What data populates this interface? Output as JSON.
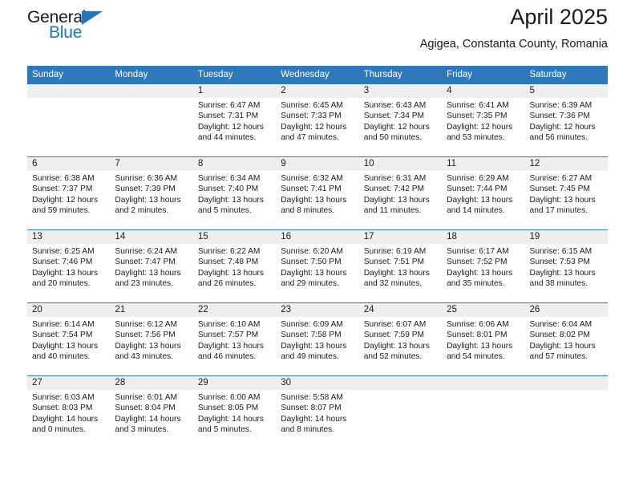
{
  "brand": {
    "name_top": "General",
    "name_bottom": "Blue",
    "triangle_color": "#1f77bd"
  },
  "header": {
    "title": "April 2025",
    "subtitle": "Agigea, Constanta County, Romania",
    "accent_color": "#2e79bb"
  },
  "calendar": {
    "weekday_headers": [
      "Sunday",
      "Monday",
      "Tuesday",
      "Wednesday",
      "Thursday",
      "Friday",
      "Saturday"
    ],
    "band_color": "#efefef",
    "weeks": [
      [
        {
          "day": "",
          "lines": []
        },
        {
          "day": "",
          "lines": []
        },
        {
          "day": "1",
          "lines": [
            "Sunrise: 6:47 AM",
            "Sunset: 7:31 PM",
            "Daylight: 12 hours",
            "and 44 minutes."
          ]
        },
        {
          "day": "2",
          "lines": [
            "Sunrise: 6:45 AM",
            "Sunset: 7:33 PM",
            "Daylight: 12 hours",
            "and 47 minutes."
          ]
        },
        {
          "day": "3",
          "lines": [
            "Sunrise: 6:43 AM",
            "Sunset: 7:34 PM",
            "Daylight: 12 hours",
            "and 50 minutes."
          ]
        },
        {
          "day": "4",
          "lines": [
            "Sunrise: 6:41 AM",
            "Sunset: 7:35 PM",
            "Daylight: 12 hours",
            "and 53 minutes."
          ]
        },
        {
          "day": "5",
          "lines": [
            "Sunrise: 6:39 AM",
            "Sunset: 7:36 PM",
            "Daylight: 12 hours",
            "and 56 minutes."
          ]
        }
      ],
      [
        {
          "day": "6",
          "lines": [
            "Sunrise: 6:38 AM",
            "Sunset: 7:37 PM",
            "Daylight: 12 hours",
            "and 59 minutes."
          ]
        },
        {
          "day": "7",
          "lines": [
            "Sunrise: 6:36 AM",
            "Sunset: 7:39 PM",
            "Daylight: 13 hours",
            "and 2 minutes."
          ]
        },
        {
          "day": "8",
          "lines": [
            "Sunrise: 6:34 AM",
            "Sunset: 7:40 PM",
            "Daylight: 13 hours",
            "and 5 minutes."
          ]
        },
        {
          "day": "9",
          "lines": [
            "Sunrise: 6:32 AM",
            "Sunset: 7:41 PM",
            "Daylight: 13 hours",
            "and 8 minutes."
          ]
        },
        {
          "day": "10",
          "lines": [
            "Sunrise: 6:31 AM",
            "Sunset: 7:42 PM",
            "Daylight: 13 hours",
            "and 11 minutes."
          ]
        },
        {
          "day": "11",
          "lines": [
            "Sunrise: 6:29 AM",
            "Sunset: 7:44 PM",
            "Daylight: 13 hours",
            "and 14 minutes."
          ]
        },
        {
          "day": "12",
          "lines": [
            "Sunrise: 6:27 AM",
            "Sunset: 7:45 PM",
            "Daylight: 13 hours",
            "and 17 minutes."
          ]
        }
      ],
      [
        {
          "day": "13",
          "lines": [
            "Sunrise: 6:25 AM",
            "Sunset: 7:46 PM",
            "Daylight: 13 hours",
            "and 20 minutes."
          ]
        },
        {
          "day": "14",
          "lines": [
            "Sunrise: 6:24 AM",
            "Sunset: 7:47 PM",
            "Daylight: 13 hours",
            "and 23 minutes."
          ]
        },
        {
          "day": "15",
          "lines": [
            "Sunrise: 6:22 AM",
            "Sunset: 7:48 PM",
            "Daylight: 13 hours",
            "and 26 minutes."
          ]
        },
        {
          "day": "16",
          "lines": [
            "Sunrise: 6:20 AM",
            "Sunset: 7:50 PM",
            "Daylight: 13 hours",
            "and 29 minutes."
          ]
        },
        {
          "day": "17",
          "lines": [
            "Sunrise: 6:19 AM",
            "Sunset: 7:51 PM",
            "Daylight: 13 hours",
            "and 32 minutes."
          ]
        },
        {
          "day": "18",
          "lines": [
            "Sunrise: 6:17 AM",
            "Sunset: 7:52 PM",
            "Daylight: 13 hours",
            "and 35 minutes."
          ]
        },
        {
          "day": "19",
          "lines": [
            "Sunrise: 6:15 AM",
            "Sunset: 7:53 PM",
            "Daylight: 13 hours",
            "and 38 minutes."
          ]
        }
      ],
      [
        {
          "day": "20",
          "lines": [
            "Sunrise: 6:14 AM",
            "Sunset: 7:54 PM",
            "Daylight: 13 hours",
            "and 40 minutes."
          ]
        },
        {
          "day": "21",
          "lines": [
            "Sunrise: 6:12 AM",
            "Sunset: 7:56 PM",
            "Daylight: 13 hours",
            "and 43 minutes."
          ]
        },
        {
          "day": "22",
          "lines": [
            "Sunrise: 6:10 AM",
            "Sunset: 7:57 PM",
            "Daylight: 13 hours",
            "and 46 minutes."
          ]
        },
        {
          "day": "23",
          "lines": [
            "Sunrise: 6:09 AM",
            "Sunset: 7:58 PM",
            "Daylight: 13 hours",
            "and 49 minutes."
          ]
        },
        {
          "day": "24",
          "lines": [
            "Sunrise: 6:07 AM",
            "Sunset: 7:59 PM",
            "Daylight: 13 hours",
            "and 52 minutes."
          ]
        },
        {
          "day": "25",
          "lines": [
            "Sunrise: 6:06 AM",
            "Sunset: 8:01 PM",
            "Daylight: 13 hours",
            "and 54 minutes."
          ]
        },
        {
          "day": "26",
          "lines": [
            "Sunrise: 6:04 AM",
            "Sunset: 8:02 PM",
            "Daylight: 13 hours",
            "and 57 minutes."
          ]
        }
      ],
      [
        {
          "day": "27",
          "lines": [
            "Sunrise: 6:03 AM",
            "Sunset: 8:03 PM",
            "Daylight: 14 hours",
            "and 0 minutes."
          ]
        },
        {
          "day": "28",
          "lines": [
            "Sunrise: 6:01 AM",
            "Sunset: 8:04 PM",
            "Daylight: 14 hours",
            "and 3 minutes."
          ]
        },
        {
          "day": "29",
          "lines": [
            "Sunrise: 6:00 AM",
            "Sunset: 8:05 PM",
            "Daylight: 14 hours",
            "and 5 minutes."
          ]
        },
        {
          "day": "30",
          "lines": [
            "Sunrise: 5:58 AM",
            "Sunset: 8:07 PM",
            "Daylight: 14 hours",
            "and 8 minutes."
          ]
        },
        {
          "day": "",
          "lines": []
        },
        {
          "day": "",
          "lines": []
        },
        {
          "day": "",
          "lines": []
        }
      ]
    ]
  }
}
